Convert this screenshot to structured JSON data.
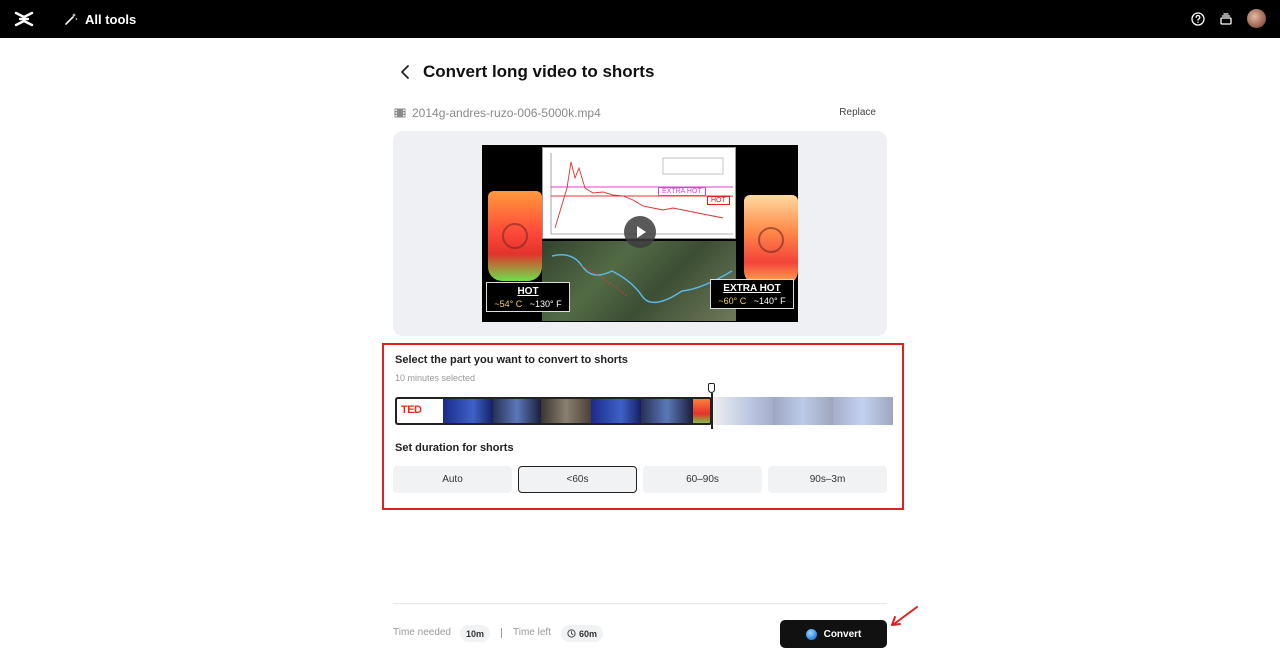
{
  "topbar": {
    "all_tools_label": "All tools"
  },
  "header": {
    "title": "Convert long video to shorts"
  },
  "file": {
    "name": "2014g-andres-ruzo-006-5000k.mp4",
    "replace_label": "Replace"
  },
  "preview": {
    "hot_label": "HOT",
    "hot_c": "~54° C",
    "hot_f": "~130° F",
    "extra_hot_label": "EXTRA HOT",
    "extra_hot_c": "~60° C",
    "extra_hot_f": "~140° F",
    "chart_extra_hot_tag": "EXTRA HOT",
    "chart_hot_tag": "HOT"
  },
  "selection": {
    "title": "Select the part you want to convert to shorts",
    "subtitle": "10 minutes selected",
    "ted_logo": "TED"
  },
  "duration": {
    "title": "Set duration for shorts",
    "options": [
      "Auto",
      "<60s",
      "60–90s",
      "90s–3m"
    ],
    "selected": "<60s"
  },
  "footer": {
    "time_needed_label": "Time needed",
    "time_needed_value": "10m",
    "time_left_label": "Time left",
    "time_left_value": "60m",
    "convert_label": "Convert"
  },
  "colors": {
    "highlight_border": "#e02020",
    "convert_bg": "#111111",
    "topbar_bg": "#000000"
  }
}
